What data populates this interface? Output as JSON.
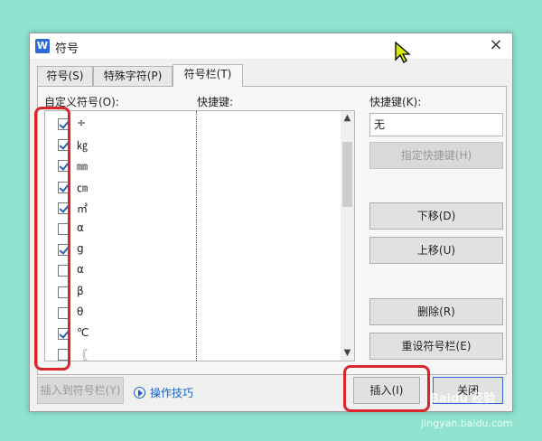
{
  "window": {
    "title": "符号",
    "app_icon_letter": "W",
    "close_glyph": "×"
  },
  "tabs": [
    {
      "label": "符号(S)",
      "active": false
    },
    {
      "label": "特殊字符(P)",
      "active": false
    },
    {
      "label": "符号栏(T)",
      "active": true
    }
  ],
  "list": {
    "header_symbols": "自定义符号(O):",
    "header_shortcut": "快捷键:",
    "rows": [
      {
        "symbol": "÷",
        "checked": true
      },
      {
        "symbol": "㎏",
        "checked": true
      },
      {
        "symbol": "㎜",
        "checked": true
      },
      {
        "symbol": "㎝",
        "checked": true
      },
      {
        "symbol": "㎡",
        "checked": true
      },
      {
        "symbol": "α",
        "checked": false
      },
      {
        "symbol": "g",
        "checked": true
      },
      {
        "symbol": "α",
        "checked": false
      },
      {
        "symbol": "β",
        "checked": false
      },
      {
        "symbol": "θ",
        "checked": false
      },
      {
        "symbol": "℃",
        "checked": true
      },
      {
        "symbol": "〖",
        "checked": false
      }
    ]
  },
  "right": {
    "shortcut_label": "快捷键(K):",
    "shortcut_value": "无",
    "assign_button": "指定快捷键(H)",
    "move_down_button": "下移(D)",
    "move_up_button": "上移(U)",
    "delete_button": "删除(R)",
    "reset_button": "重设符号栏(E)"
  },
  "bottom": {
    "insert_to_bar_button": "插入到符号栏(Y)",
    "tips_link": "操作技巧",
    "insert_button": "插入(I)",
    "close_button": "关闭"
  },
  "watermark": {
    "brand": "Baidu 经验",
    "url": "jingyan.baidu.com"
  },
  "colors": {
    "background": "#8fe3cf",
    "highlight": "#d9262b",
    "accent": "#2d6bd8",
    "link": "#1a62c9"
  }
}
